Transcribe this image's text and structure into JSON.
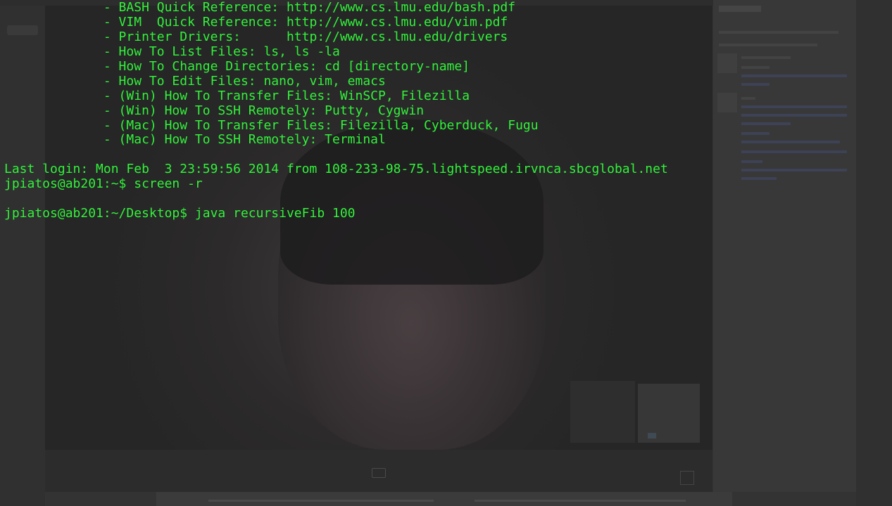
{
  "terminal": {
    "lines": [
      "             - BASH Quick Reference: http://www.cs.lmu.edu/bash.pdf",
      "             - VIM  Quick Reference: http://www.cs.lmu.edu/vim.pdf",
      "             - Printer Drivers:      http://www.cs.lmu.edu/drivers",
      "             - How To List Files: ls, ls -la",
      "             - How To Change Directories: cd [directory-name]",
      "             - How To Edit Files: nano, vim, emacs",
      "             - (Win) How To Transfer Files: WinSCP, Filezilla",
      "             - (Win) How To SSH Remotely: Putty, Cygwin",
      "             - (Mac) How To Transfer Files: Filezilla, Cyberduck, Fugu",
      "             - (Mac) How To SSH Remotely: Terminal",
      "",
      "Last login: Mon Feb  3 23:59:56 2014 from 108-233-98-75.lightspeed.irvnca.sbcglobal.net",
      "jpiatos@ab201:~$ screen -r",
      "",
      "jpiatos@ab201:~/Desktop$ java recursiveFib 100"
    ],
    "text_color": "#31f23a",
    "background_color": "#333333"
  },
  "background_video_call": {
    "camera_icon": "camera-icon",
    "expand_icon": "expand-icon"
  }
}
